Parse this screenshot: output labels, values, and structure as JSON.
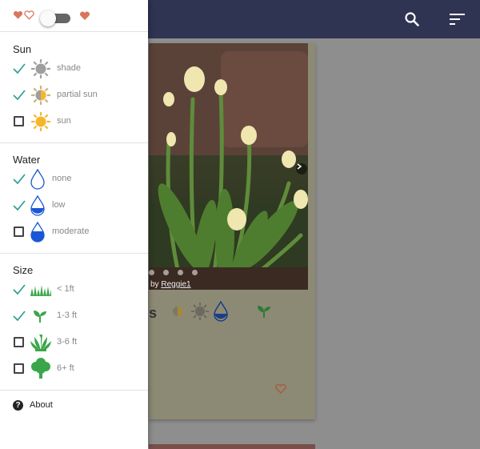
{
  "drawer": {
    "favorites_toggle": {
      "on": false
    },
    "sections": [
      {
        "title": "Sun",
        "options": [
          {
            "label": "shade",
            "checked": true,
            "icon": "sun-shade-icon"
          },
          {
            "label": "partial sun",
            "checked": true,
            "icon": "sun-partial-icon"
          },
          {
            "label": "sun",
            "checked": false,
            "icon": "sun-full-icon"
          }
        ]
      },
      {
        "title": "Water",
        "options": [
          {
            "label": "none",
            "checked": true,
            "icon": "water-none-icon"
          },
          {
            "label": "low",
            "checked": true,
            "icon": "water-low-icon"
          },
          {
            "label": "moderate",
            "checked": false,
            "icon": "water-moderate-icon"
          }
        ]
      },
      {
        "title": "Size",
        "options": [
          {
            "label": "< 1ft",
            "checked": true,
            "icon": "grass-icon"
          },
          {
            "label": "1-3 ft",
            "checked": true,
            "icon": "sprout-icon"
          },
          {
            "label": "3-6 ft",
            "checked": false,
            "icon": "shrub-icon"
          },
          {
            "label": "6+ ft",
            "checked": false,
            "icon": "tree-icon"
          }
        ]
      }
    ],
    "about_label": "About"
  },
  "card": {
    "credit_prefix": "by",
    "credit_author": "Reggie1",
    "title_fragment": "s",
    "image_dots": 4
  },
  "colors": {
    "appbar": "#2f3452",
    "check": "#2a9d8f",
    "heart": "#d9775d",
    "water": "#1a57d6",
    "plant": "#3aa64a",
    "sun": "#f6b62c",
    "shade": "#9e9e9e"
  }
}
